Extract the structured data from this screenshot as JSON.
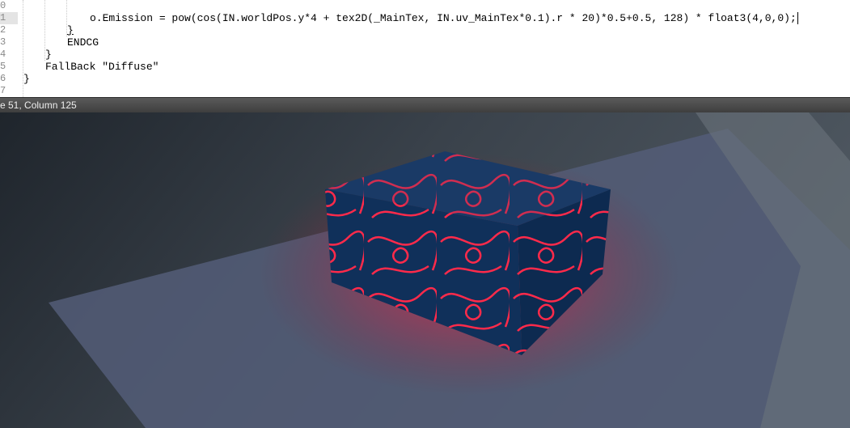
{
  "editor": {
    "line_numbers": [
      "0",
      "1",
      "2",
      "3",
      "4",
      "5",
      "6",
      "7"
    ],
    "current_line_index": 1,
    "lines": [
      "",
      "o.Emission = pow(cos(IN.worldPos.y*4 + tex2D(_MainTex, IN.uv_MainTex*0.1).r * 20)*0.5+0.5, 128) * float3(4,0,0);",
      "}",
      "ENDCG",
      "}",
      "FallBack \"Diffuse\"",
      "}",
      ""
    ]
  },
  "status_bar": {
    "position": "e 51, Column 125"
  },
  "scene": {
    "emission_color": "#ff2a4a",
    "box_color": "#10305a"
  }
}
